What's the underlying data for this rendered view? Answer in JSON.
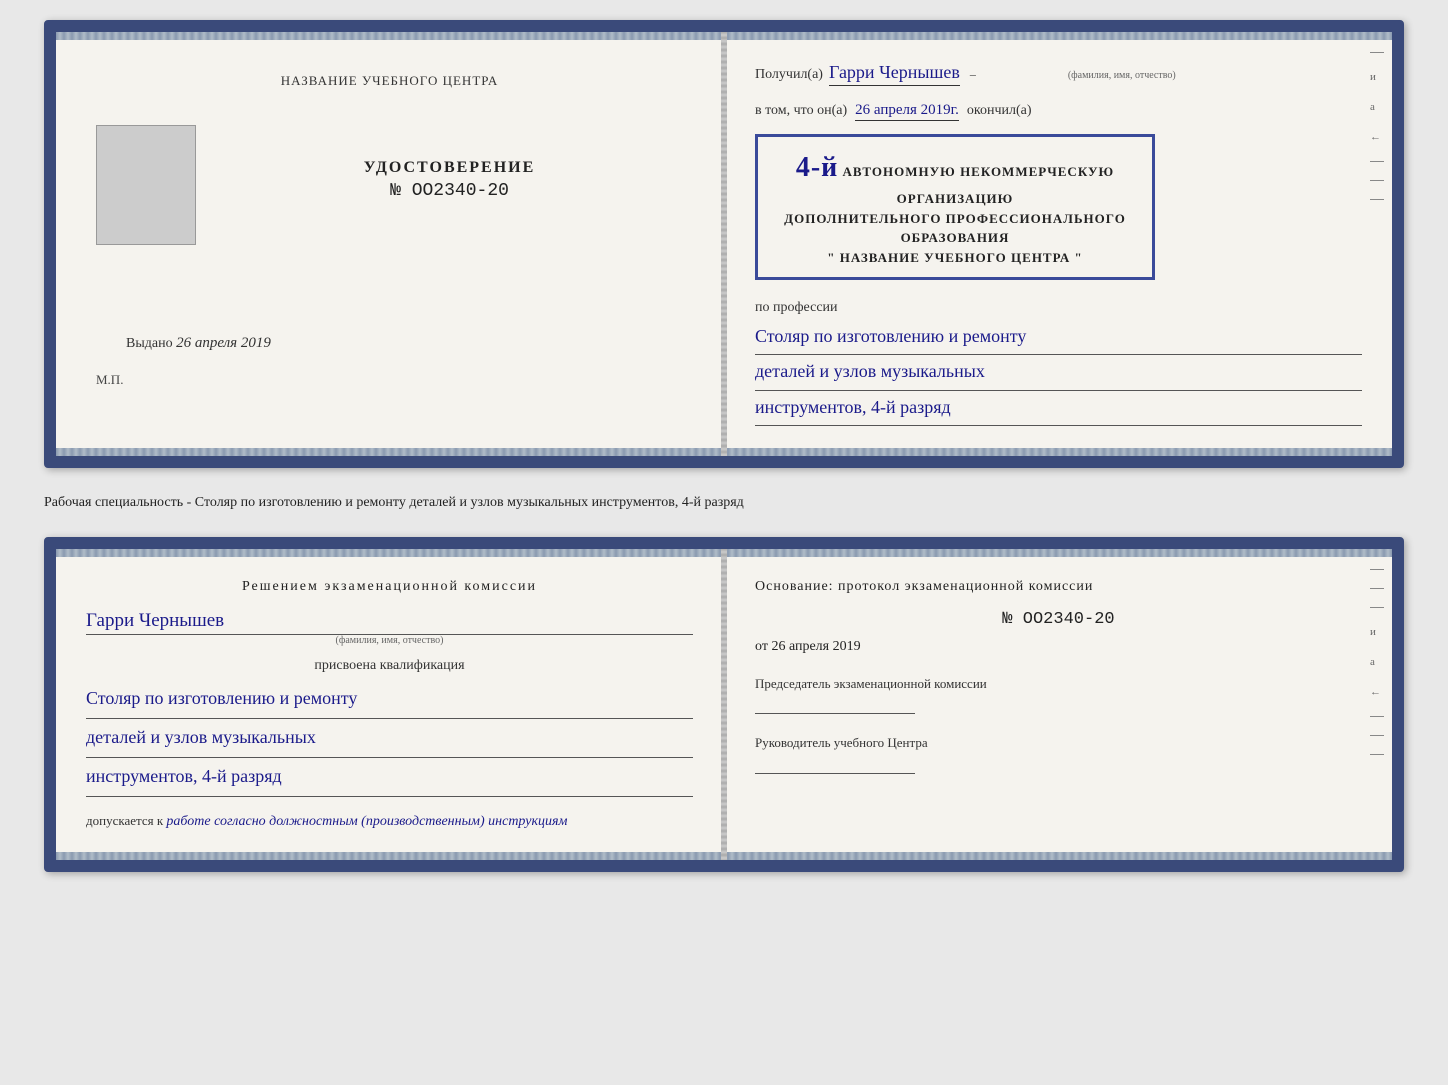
{
  "top_spread": {
    "left_page": {
      "title": "НАЗВАНИЕ УЧЕБНОГО ЦЕНТРА",
      "udostoverenie": "УДОСТОВЕРЕНИЕ",
      "number_prefix": "№",
      "number": "OO2340-20",
      "vydano_label": "Выдано",
      "vydano_date": "26 апреля 2019",
      "mp": "М.П."
    },
    "right_page": {
      "poluchil_label": "Получил(а)",
      "recipient_name": "Гарри Чернышев",
      "fio_subtext": "(фамилия, имя, отчество)",
      "vtom_label": "в том, что он(а)",
      "vtom_date": "26 апреля 2019г.",
      "okonchil_label": "окончил(а)",
      "stamp_line1": "АВТОНОМНУЮ НЕКОММЕРЧЕСКУЮ ОРГАНИЗАЦИЮ",
      "stamp_line2": "ДОПОЛНИТЕЛЬНОГО ПРОФЕССИОНАЛЬНОГО ОБРАЗОВАНИЯ",
      "stamp_line3": "\" НАЗВАНИЕ УЧЕБНОГО ЦЕНТРА \"",
      "stamp_grade": "4-й",
      "po_professii": "по профессии",
      "profession_line1": "Столяр по изготовлению и ремонту",
      "profession_line2": "деталей и узлов музыкальных",
      "profession_line3": "инструментов, 4-й разряд",
      "side_letters": [
        "–",
        "и",
        "а",
        "←",
        "–"
      ]
    }
  },
  "between_text": "Рабочая специальность - Столяр по изготовлению и ремонту деталей и узлов музыкальных инструментов, 4-й разряд",
  "bottom_spread": {
    "left_page": {
      "decision_title": "Решением экзаменационной комиссии",
      "recipient_name": "Гарри Чернышев",
      "fio_subtext": "(фамилия, имя, отчество)",
      "prisvoena": "присвоена квалификация",
      "qualification_line1": "Столяр по изготовлению и ремонту",
      "qualification_line2": "деталей и узлов музыкальных",
      "qualification_line3": "инструментов, 4-й разряд",
      "dopuskaetsya": "допускается к",
      "dopuskaetsya_value": "работе согласно должностным (производственным) инструкциям"
    },
    "right_page": {
      "osnование": "Основание: протокол экзаменационной комиссии",
      "number_prefix": "№",
      "number": "OO2340-20",
      "ot_label": "от",
      "date": "26 апреля 2019",
      "chairman_title": "Председатель экзаменационной комиссии",
      "rukovoditel_title": "Руководитель учебного Центра",
      "side_letters": [
        "–",
        "–",
        "–",
        "и",
        "а",
        "←",
        "–",
        "–",
        "–"
      ]
    }
  }
}
